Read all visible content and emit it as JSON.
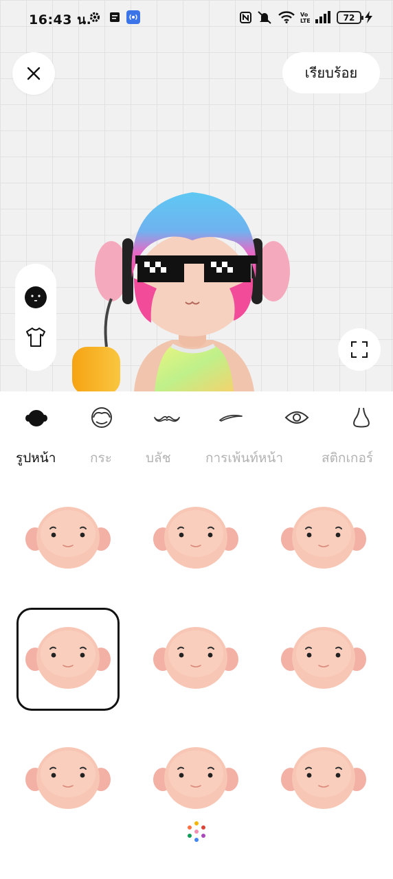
{
  "status_bar": {
    "time": "16:43 น.",
    "battery": "72",
    "icons": [
      "gear-icon",
      "message-icon",
      "hotspot-icon",
      "nfc-icon",
      "mute-icon",
      "wifi-icon",
      "volte-icon",
      "signal-icon",
      "battery-icon",
      "charging-icon"
    ]
  },
  "preview": {
    "close_icon": "close-icon",
    "done_label": "เรียบร้อย",
    "side_buttons": [
      "face-icon",
      "shirt-icon"
    ],
    "fullscreen_icon": "fullscreen-icon"
  },
  "editor": {
    "categories": [
      "head-shape-icon",
      "hair-icon",
      "mustache-icon",
      "eyebrow-icon",
      "eye-icon",
      "nose-icon"
    ],
    "active_category": 0,
    "subtabs": [
      {
        "label": "รูปหน้า",
        "active": true
      },
      {
        "label": "กระ",
        "active": false
      },
      {
        "label": "บลัช",
        "active": false
      },
      {
        "label": "การเพ้นท์หน้า",
        "active": false
      },
      {
        "label": "สติกเกอร์",
        "active": false
      }
    ],
    "face_options": [
      {
        "selected": false
      },
      {
        "selected": false
      },
      {
        "selected": false
      },
      {
        "selected": true
      },
      {
        "selected": false
      },
      {
        "selected": false
      },
      {
        "selected": false
      },
      {
        "selected": false
      },
      {
        "selected": false
      }
    ],
    "loading_icon": "loading-dots-icon"
  },
  "colors": {
    "hair_blue": "#5ec8f2",
    "hair_pink": "#f24b9a",
    "skin": "#f6c9b6",
    "tab_inactive": "#b2b2b2"
  }
}
